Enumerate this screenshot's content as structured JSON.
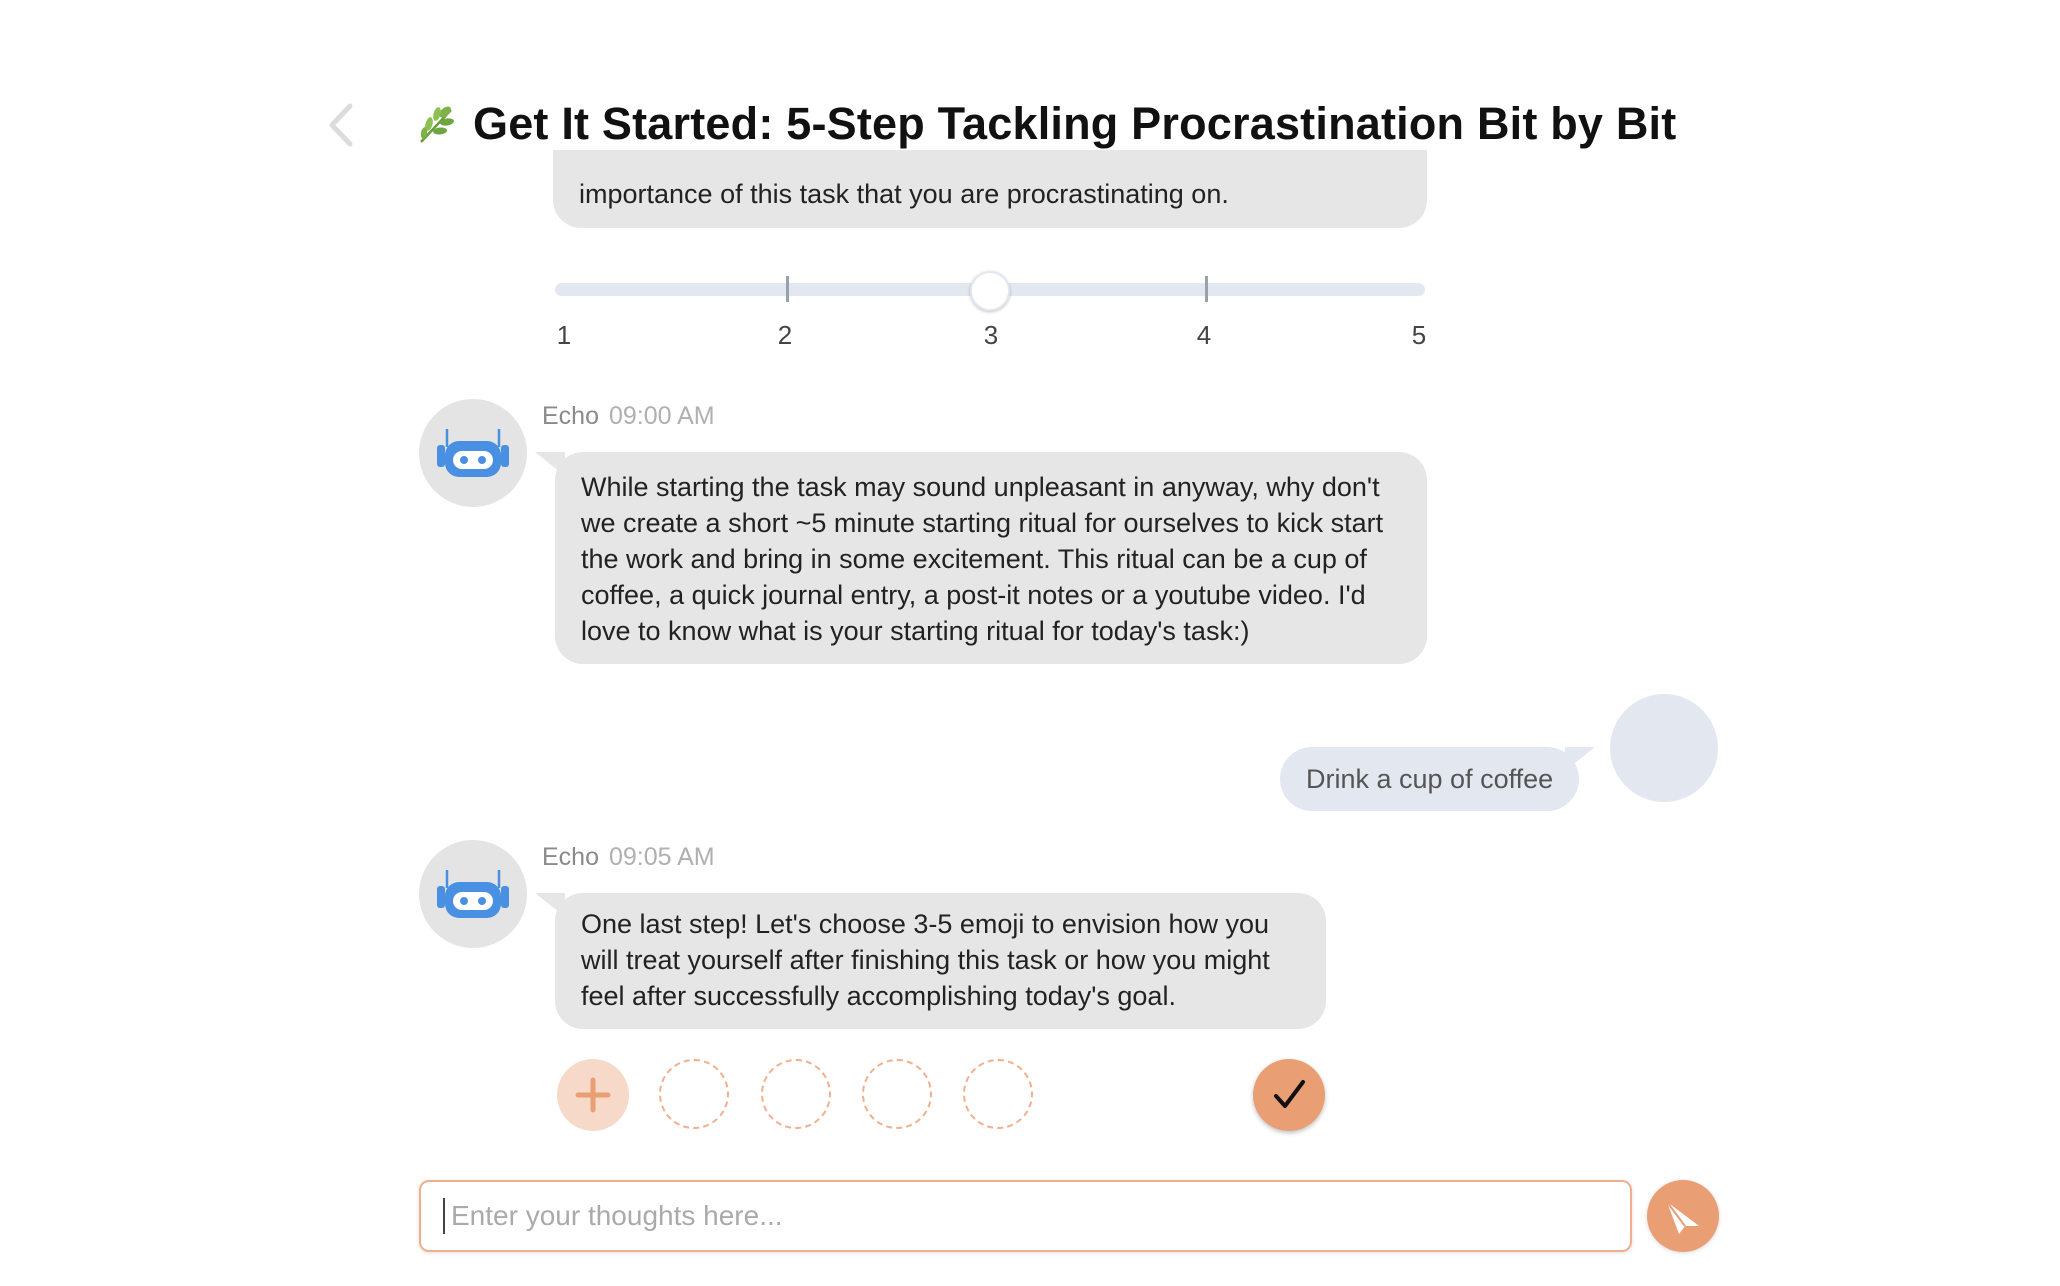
{
  "header": {
    "back_icon": "chevron-left-icon",
    "title_icon": "leaf-icon",
    "title": "Get It Started: 5-Step Tackling Procrastination Bit by Bit"
  },
  "messages": {
    "previous_bubble_text": "importance of this task that you are procrastinating on.",
    "slider": {
      "labels": [
        "1",
        "2",
        "3",
        "4",
        "5"
      ],
      "selected_value": 3,
      "min": 1,
      "max": 5
    },
    "bot1": {
      "name": "Echo",
      "time": "09:00 AM",
      "avatar_icon": "robot-icon",
      "text": "While starting the task may sound unpleasant in anyway, why don't we create a short ~5 minute starting ritual for ourselves to kick start the work and bring in some excitement. This ritual can be a cup of coffee, a quick journal entry, a post-it notes or a youtube video. I'd love to know what is your starting ritual for today's task:)"
    },
    "user1": {
      "text": "Drink a cup of coffee"
    },
    "bot2": {
      "name": "Echo",
      "time": "09:05 AM",
      "avatar_icon": "robot-icon",
      "text": "One last step! Let's choose 3-5 emoji to envision how you will treat yourself after finishing this task or how you might feel after successfully accomplishing today's goal."
    },
    "emoji_picker": {
      "add_icon": "plus-icon",
      "empty_slots": 4,
      "confirm_icon": "checkmark-icon"
    }
  },
  "composer": {
    "placeholder": "Enter your thoughts here...",
    "value": "",
    "send_icon": "send-paper-plane-icon"
  },
  "colors": {
    "accent": "#ea9e74",
    "accent_light": "#f6d9c9",
    "bot_bubble": "#e6e6e6",
    "user_bubble": "#e3e8f0",
    "robot_blue": "#4a90e2"
  }
}
